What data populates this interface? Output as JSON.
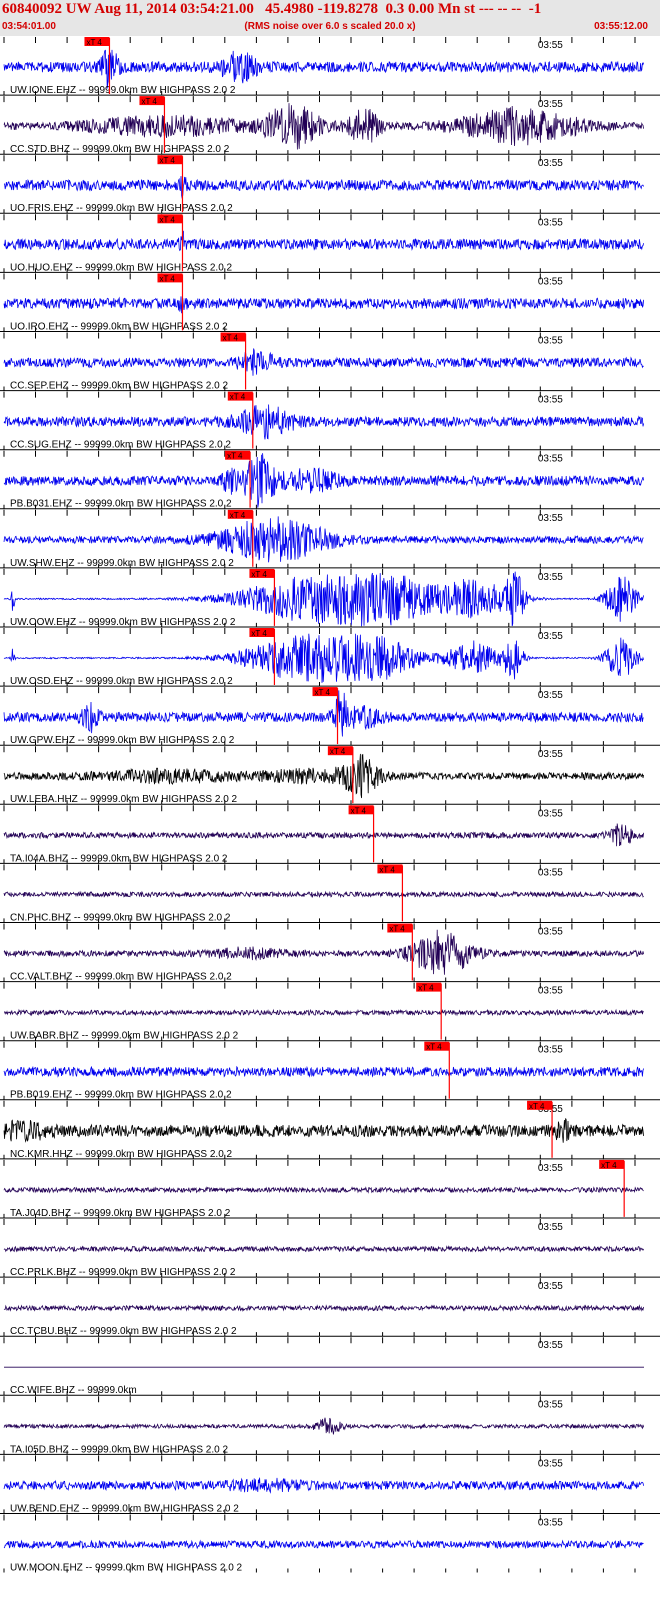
{
  "header": {
    "title": "60840092 UW Aug 11, 2014 03:54:21.00   45.4980 -119.8278  0.3 0.00 Mn st --- -- --  -1",
    "start_time": "03:54:01.00",
    "end_time": "03:55:12.00",
    "rms_note": "(RMS noise over 6.0 s scaled 20.0 x)"
  },
  "chart_data": {
    "type": "line",
    "tick_label": "03:55",
    "pick_label": "xT 4",
    "x_range_s": [
      0,
      71
    ],
    "minute_mark_s": 59,
    "tick_interval_s": 3.5,
    "traces": [
      {
        "label": "UW.IONE.EHZ -- 99999.0km BW  HIGHPASS  2.0  2",
        "color": "#0000ee",
        "pick_s": 11.7,
        "amp": 0.22,
        "bursts": [
          [
            11.7,
            0.6,
            0.75
          ],
          [
            26,
            1.3,
            0.55
          ]
        ]
      },
      {
        "label": "CC.STD.BHZ -- 99999.0km BW  HIGHPASS  2.0  2",
        "color": "#220055",
        "pick_s": 17.8,
        "amp": 0.15,
        "bursts": [
          [
            18,
            6,
            0.35
          ],
          [
            32,
            2,
            0.85
          ],
          [
            40,
            1.2,
            0.7
          ],
          [
            57,
            4.5,
            0.7
          ]
        ]
      },
      {
        "label": "UO.FRIS.EHZ -- 99999.0km BW  HIGHPASS  2.0  2",
        "color": "#0000ee",
        "pick_s": 19.8,
        "amp": 0.22,
        "bursts": [
          [
            19.8,
            0.25,
            0.4
          ]
        ]
      },
      {
        "label": "UO.HUO.EHZ -- 99999.0km BW  HIGHPASS  2.0  2",
        "color": "#0000ee",
        "pick_s": 19.8,
        "amp": 0.22,
        "bursts": [
          [
            19.8,
            0.25,
            0.4
          ]
        ]
      },
      {
        "label": "UO.IRO.EHZ -- 99999.0km BW  HIGHPASS  2.0  2",
        "color": "#0000ee",
        "pick_s": 19.8,
        "amp": 0.22,
        "bursts": [
          [
            19.8,
            0.25,
            0.4
          ]
        ]
      },
      {
        "label": "CC.SEP.EHZ -- 99999.0km BW  HIGHPASS  2.0  2",
        "color": "#0000ee",
        "pick_s": 26.8,
        "amp": 0.2,
        "bursts": [
          [
            28,
            1.2,
            0.45
          ]
        ]
      },
      {
        "label": "CC.SUG.EHZ -- 99999.0km BW  HIGHPASS  2.0  2",
        "color": "#0000ee",
        "pick_s": 27.6,
        "amp": 0.2,
        "bursts": [
          [
            29,
            2,
            0.6
          ]
        ]
      },
      {
        "label": "PB.B031.EHZ -- 99999.0km BW  HIGHPASS  2.0  2",
        "color": "#0000ee",
        "pick_s": 27.3,
        "amp": 0.2,
        "bursts": [
          [
            28.3,
            1.2,
            1.0
          ],
          [
            25,
            0.5,
            0.4
          ],
          [
            34,
            2,
            0.4
          ]
        ]
      },
      {
        "label": "UW.SHW.EHZ -- 99999.0km BW  HIGHPASS  2.0  2",
        "color": "#0000ee",
        "pick_s": 27.6,
        "amp": 0.15,
        "bursts": [
          [
            30,
            4,
            0.85
          ]
        ]
      },
      {
        "label": "UW.OOW.EHZ -- 99999.0km BW  HIGHPASS  2.0  2",
        "color": "#0000ee",
        "pick_s": 30.0,
        "amp": 0.03,
        "bursts": [
          [
            35,
            6,
            1.0
          ],
          [
            43,
            3,
            0.7
          ],
          [
            52,
            3,
            0.8
          ],
          [
            56.7,
            0.7,
            1.0
          ],
          [
            68.5,
            1.2,
            0.95
          ],
          [
            1,
            0.12,
            0.6
          ]
        ]
      },
      {
        "label": "UW.OSD.EHZ -- 99999.0km BW  HIGHPASS  2.0  2",
        "color": "#0000ee",
        "pick_s": 30.0,
        "amp": 0.03,
        "bursts": [
          [
            34,
            5,
            1.0
          ],
          [
            42,
            3,
            0.65
          ],
          [
            52,
            2,
            0.7
          ],
          [
            56.5,
            0.7,
            0.95
          ],
          [
            68.5,
            1.2,
            0.85
          ],
          [
            1,
            0.12,
            0.5
          ]
        ]
      },
      {
        "label": "UW.GPW.EHZ -- 99999.0km BW  HIGHPASS  2.0  2",
        "color": "#0000ee",
        "pick_s": 37.0,
        "amp": 0.2,
        "bursts": [
          [
            37.3,
            0.45,
            1.0
          ],
          [
            39.5,
            1.5,
            0.4
          ],
          [
            9.5,
            0.6,
            0.5
          ]
        ]
      },
      {
        "label": "UW.LEBA.HHZ -- 99999.0km BW  HIGHPASS  2.0  2",
        "color": "#000000",
        "pick_s": 38.7,
        "amp": 0.15,
        "bursts": [
          [
            39.5,
            1.3,
            0.8
          ],
          [
            18,
            5,
            0.2
          ],
          [
            34,
            4,
            0.2
          ]
        ]
      },
      {
        "label": "TA.I04A.BHZ -- 99999.0km BW  HIGHPASS  2.0  2",
        "color": "#220055",
        "pick_s": 41.0,
        "amp": 0.12,
        "bursts": [
          [
            68.5,
            0.8,
            0.45
          ]
        ]
      },
      {
        "label": "CN.PHC.BHZ -- 99999.0km BW  HIGHPASS  2.0  2",
        "color": "#220055",
        "pick_s": 44.2,
        "amp": 0.1,
        "bursts": []
      },
      {
        "label": "CC.VALT.BHZ -- 99999.0km BW  HIGHPASS  2.0  2",
        "color": "#220055",
        "pick_s": 45.3,
        "amp": 0.12,
        "bursts": [
          [
            48.5,
            2.3,
            0.9
          ],
          [
            27,
            3,
            0.18
          ]
        ]
      },
      {
        "label": "UW.BABR.BHZ -- 99999.0km BW  HIGHPASS  2.0  2",
        "color": "#220055",
        "pick_s": 48.5,
        "amp": 0.1,
        "bursts": []
      },
      {
        "label": "PB.B019.EHZ -- 99999.0km BW  HIGHPASS  2.0  2",
        "color": "#0000ee",
        "pick_s": 49.4,
        "amp": 0.2,
        "bursts": []
      },
      {
        "label": "NC.KMR.HHZ -- 99999.0km BW  HIGHPASS  2.0  2",
        "color": "#000000",
        "pick_s": 60.8,
        "amp": 0.25,
        "bursts": [
          [
            62,
            0.5,
            0.4
          ],
          [
            2,
            2,
            0.25
          ]
        ]
      },
      {
        "label": "TA.J04D.BHZ -- 99999.0km BW  HIGHPASS  2.0  2",
        "color": "#220055",
        "pick_s": 68.8,
        "amp": 0.1,
        "bursts": []
      },
      {
        "label": "CC.PRLK.BHZ -- 99999.0km BW  HIGHPASS  2.0  2",
        "color": "#220055",
        "pick_s": null,
        "amp": 0.1,
        "bursts": []
      },
      {
        "label": "CC.TCBU.BHZ -- 99999.0km BW  HIGHPASS  2.0  2",
        "color": "#220055",
        "pick_s": null,
        "amp": 0.1,
        "bursts": []
      },
      {
        "label": "CC.WIFE.BHZ -- 99999.0km",
        "color": "#220055",
        "pick_s": null,
        "amp": 0,
        "bursts": []
      },
      {
        "label": "TA.I05D.BHZ -- 99999.0km BW  HIGHPASS  2.0  2",
        "color": "#220055",
        "pick_s": null,
        "amp": 0.08,
        "bursts": [
          [
            36,
            1,
            0.3
          ]
        ]
      },
      {
        "label": "UW.BEND.EHZ -- 99999.0km BW  HIGHPASS  2.0  2",
        "color": "#0000ee",
        "pick_s": null,
        "amp": 0.18,
        "bursts": [
          [
            29,
            3,
            0.15
          ]
        ]
      },
      {
        "label": "UW.MOON.EHZ -- 99999.0km BW  HIGHPASS  2.0  2",
        "color": "#0000ee",
        "pick_s": null,
        "amp": 0.15,
        "bursts": []
      }
    ]
  }
}
